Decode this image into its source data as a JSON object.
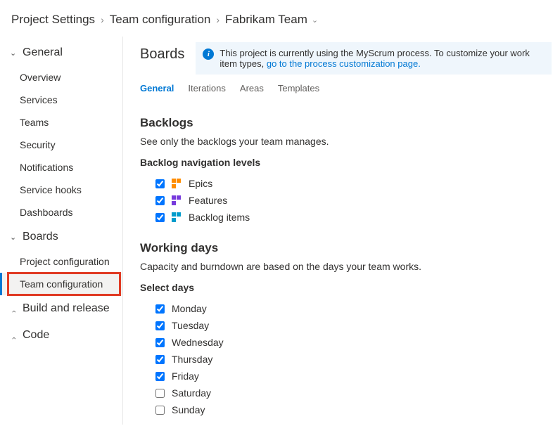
{
  "breadcrumb": {
    "root": "Project Settings",
    "mid": "Team configuration",
    "team": "Fabrikam Team"
  },
  "sidebar": {
    "groups": [
      {
        "label": "General",
        "expanded": true,
        "items": [
          {
            "label": "Overview"
          },
          {
            "label": "Services"
          },
          {
            "label": "Teams"
          },
          {
            "label": "Security"
          },
          {
            "label": "Notifications"
          },
          {
            "label": "Service hooks"
          },
          {
            "label": "Dashboards"
          }
        ]
      },
      {
        "label": "Boards",
        "expanded": true,
        "items": [
          {
            "label": "Project configuration"
          },
          {
            "label": "Team configuration",
            "active": true,
            "highlight": true
          }
        ]
      },
      {
        "label": "Build and release",
        "expanded": false,
        "items": []
      },
      {
        "label": "Code",
        "expanded": false,
        "items": []
      }
    ]
  },
  "main": {
    "title": "Boards",
    "banner": {
      "text": "This project is currently using the MyScrum process. To customize your work item types, ",
      "link": "go to the process customization page."
    },
    "tabs": [
      {
        "label": "General",
        "active": true
      },
      {
        "label": "Iterations"
      },
      {
        "label": "Areas"
      },
      {
        "label": "Templates"
      }
    ],
    "backlogs": {
      "heading": "Backlogs",
      "desc": "See only the backlogs your team manages.",
      "subhead": "Backlog navigation levels",
      "levels": [
        {
          "label": "Epics",
          "checked": true,
          "icon": "epics"
        },
        {
          "label": "Features",
          "checked": true,
          "icon": "features"
        },
        {
          "label": "Backlog items",
          "checked": true,
          "icon": "backlog"
        }
      ]
    },
    "workingdays": {
      "heading": "Working days",
      "desc": "Capacity and burndown are based on the days your team works.",
      "subhead": "Select days",
      "days": [
        {
          "label": "Monday",
          "checked": true
        },
        {
          "label": "Tuesday",
          "checked": true
        },
        {
          "label": "Wednesday",
          "checked": true
        },
        {
          "label": "Thursday",
          "checked": true
        },
        {
          "label": "Friday",
          "checked": true
        },
        {
          "label": "Saturday",
          "checked": false
        },
        {
          "label": "Sunday",
          "checked": false
        }
      ]
    }
  }
}
